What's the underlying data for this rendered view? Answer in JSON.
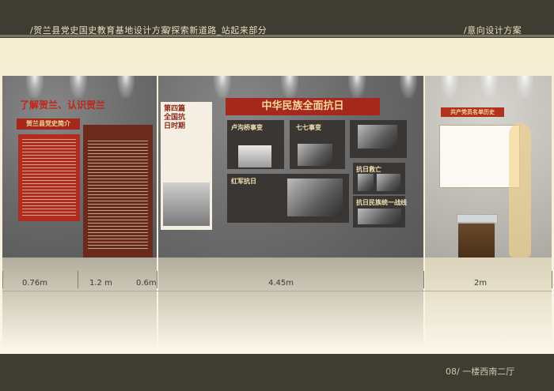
{
  "header": {
    "breadcrumb_1": "/贺兰县党史国史教育基地设计方案",
    "breadcrumb_2": "/探索新道路_站起来部分",
    "right_label": "/意向设计方案"
  },
  "left_wall": {
    "title": "了解贺兰、认识贺兰",
    "subtitle": "贺兰县党史简介"
  },
  "middle_wall": {
    "side_panel_title": "第四篇 全国抗日时期",
    "banner": "中华民族全面抗日",
    "boxes": [
      "卢沟桥事变",
      "七七事变",
      "抗日救亡",
      "红军抗日",
      "抗日民族统一战线"
    ]
  },
  "right_wall": {
    "title": "共产党员名单历史"
  },
  "dimensions": [
    "0.76m",
    "1.2 m",
    "0.6m",
    "4.45m",
    "2m"
  ],
  "footer": {
    "page_label": "08/  一楼西南二厅"
  },
  "colors": {
    "bar": "#3f3d32",
    "banner_red": "#a5281c",
    "wall_gray": "#6e6e6e",
    "cream": "#f6f0d8"
  }
}
